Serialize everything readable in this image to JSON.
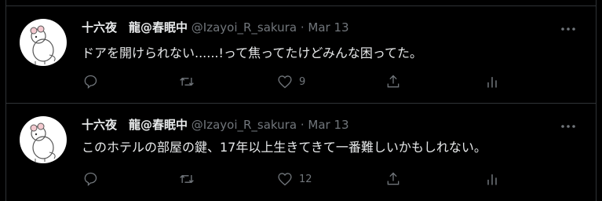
{
  "tweets": [
    {
      "display_name": "十六夜　龍@春眠中",
      "handle": "@Izayoi_R_sakura",
      "separator": "·",
      "date": "Mar 13",
      "text": "ドアを開けられない......!って焦ってたけどみんな困ってた。",
      "like_count": "9"
    },
    {
      "display_name": "十六夜　龍@春眠中",
      "handle": "@Izayoi_R_sakura",
      "separator": "·",
      "date": "Mar 13",
      "text": "このホテルの部屋の鍵、17年以上生きてきて一番難しいかもしれない。",
      "like_count": "12"
    }
  ],
  "icons": {
    "reply": "reply-icon",
    "retweet": "retweet-icon",
    "like": "heart-icon",
    "share": "share-icon",
    "analytics": "analytics-icon",
    "more": "more-icon"
  },
  "colors": {
    "background": "#000000",
    "text": "#e7e9ea",
    "secondary": "#71767b",
    "border": "#2f3336"
  }
}
